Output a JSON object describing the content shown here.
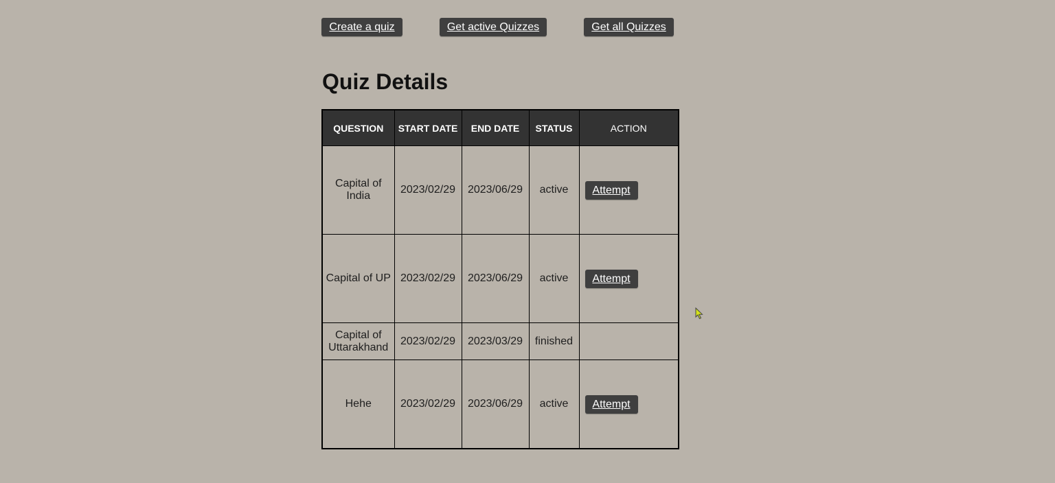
{
  "nav": {
    "create_label": "Create a quiz",
    "active_label": "Get active Quizzes",
    "all_label": "Get all Quizzes"
  },
  "page": {
    "title": "Quiz Details"
  },
  "table": {
    "headers": {
      "question": "QUESTION",
      "start_date": "START DATE",
      "end_date": "END DATE",
      "status": "STATUS",
      "action": "ACTION"
    },
    "rows": [
      {
        "question": "Capital of India",
        "start_date": "2023/02/29",
        "end_date": "2023/06/29",
        "status": "active",
        "action": "Attempt"
      },
      {
        "question": "Capital of UP",
        "start_date": "2023/02/29",
        "end_date": "2023/06/29",
        "status": "active",
        "action": "Attempt"
      },
      {
        "question": "Capital of Uttarakhand",
        "start_date": "2023/02/29",
        "end_date": "2023/03/29",
        "status": "finished",
        "action": ""
      },
      {
        "question": "Hehe",
        "start_date": "2023/02/29",
        "end_date": "2023/06/29",
        "status": "active",
        "action": "Attempt"
      }
    ]
  },
  "colors": {
    "page_background": "#b9b3aa",
    "button_background": "#3f3f3f",
    "header_background": "#333333",
    "cursor": "#d4e21a"
  },
  "icons": {
    "cursor": "mouse-pointer-icon"
  }
}
